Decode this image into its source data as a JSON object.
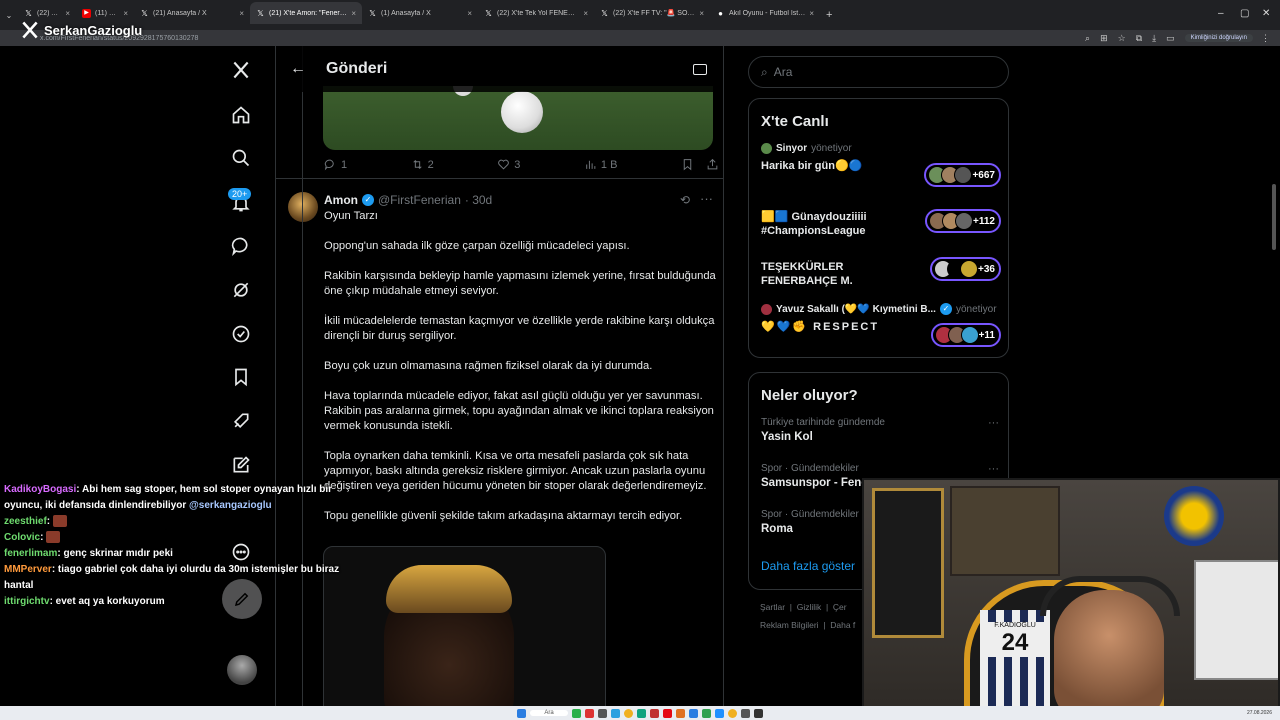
{
  "browser": {
    "tabs": [
      {
        "label": "(22) Ana",
        "icon": "x-logo",
        "active": false
      },
      {
        "label": "(11) PEDR",
        "icon": "youtube-icon",
        "active": false
      },
      {
        "label": "(21) Anasayfa / X",
        "icon": "x-logo",
        "active": false
      },
      {
        "label": "(21) X'te Amon: \"Fenerbahçe'ni",
        "icon": "x-logo",
        "active": true
      },
      {
        "label": "(1) Anasayfa / X",
        "icon": "x-logo",
        "active": false
      },
      {
        "label": "(22) X'te Tek Yol FENER: \"#SON",
        "icon": "x-logo",
        "active": false
      },
      {
        "label": "(22) X'te FF TV: \"🚨 SON DAKİ",
        "icon": "x-logo",
        "active": false
      },
      {
        "label": "Akıl Oyunu - Futbol İstatistikleri",
        "icon": "site-icon",
        "active": false
      }
    ],
    "new_tab": "+",
    "url": "x.com/FirstFenerian/status/2092928175760130278",
    "verify_label": "Kimliğinizi doğrulayın",
    "streamer_overlay": "SerkanGazioglu"
  },
  "nav": {
    "notification_badge": "20+"
  },
  "header": {
    "title": "Gönderi"
  },
  "prev_post_actions": {
    "replies": "1",
    "reposts": "2",
    "likes": "3",
    "views": "1 B"
  },
  "post": {
    "name": "Amon",
    "handle": "@FirstFenerian",
    "time": "· 30d",
    "paragraphs": [
      "Oyun Tarzı",
      "Oppong'un sahada ilk göze çarpan özelliği mücadeleci yapısı.",
      "Rakibin karşısında bekleyip hamle yapmasını izlemek yerine, fırsat bulduğunda öne çıkıp müdahale etmeyi seviyor.",
      "İkili mücadelelerde temastan kaçmıyor ve özellikle yerde rakibine karşı oldukça dirençli bir duruş sergiliyor.",
      "Boyu çok uzun olmamasına rağmen fiziksel olarak da iyi durumda.",
      "Hava toplarında mücadele ediyor, fakat asıl güçlü olduğu yer yer savunması. Rakibin pas aralarına girmek, topu ayağından almak ve ikinci toplara reaksiyon vermek konusunda istekli.",
      "Topla oynarken daha temkinli. Kısa ve orta mesafeli paslarda çok sık hata yapmıyor, baskı altında gereksiz risklere girmiyor. Ancak uzun paslarla oyunu değiştiren veya geriden hücumu yöneten bir stoper olarak değerlendiremeyiz.",
      "Topu genellikle güvenli şekilde takım arkadaşına aktarmayı tercih ediyor."
    ]
  },
  "search": {
    "placeholder": "Ara"
  },
  "live": {
    "title": "X'te Canlı",
    "items": [
      {
        "host": "Sinyor",
        "role": "yönetiyor",
        "title": "Harika bir gün🟡🔵",
        "count": "+667"
      },
      {
        "host": "",
        "role": "",
        "title": "🟨🟦 Günaydouziiiii #ChampionsLeague",
        "count": "+112"
      },
      {
        "host": "",
        "role": "",
        "title": "TEŞEKKÜRLER FENERBAHÇE M.",
        "count": "+36"
      },
      {
        "host": "Yavuz Sakallı (💛💙 Kıymetini B...",
        "role": "yönetiyor",
        "title": "💛💙✊ RESPECT",
        "count": "+11"
      }
    ]
  },
  "trends": {
    "title": "Neler oluyor?",
    "items": [
      {
        "context": "Türkiye tarihinde gündemde",
        "name": "Yasin Kol"
      },
      {
        "context": "Spor · Gündemdekiler",
        "name": "Samsunspor - Fene"
      },
      {
        "context": "Spor · Gündemdekiler",
        "name": "Roma"
      }
    ],
    "show_more": "Daha fazla göster"
  },
  "footer": {
    "links": [
      "Şartlar",
      "Gizlilik",
      "Çer",
      "Reklam Bilgileri",
      "Daha f"
    ]
  },
  "chat": [
    {
      "user": "KadikoyBogasi",
      "color": "#d86bff",
      "text": ": Abi hem sag stoper, hem sol stoper oynayan hızlı bir oyuncu, iki defansıda dinlendirebiliyor",
      "mention": "@serkangazioglu"
    },
    {
      "user": "zeesthief",
      "color": "#6fdc6f",
      "text": ": ",
      "emote": true
    },
    {
      "user": "Colovic",
      "color": "#6fdc6f",
      "text": ": ",
      "emote": true
    },
    {
      "user": "fenerlimam",
      "color": "#6fdc6f",
      "text": ": genç skrinar mıdır peki"
    },
    {
      "user": "MMPerver",
      "color": "#ff9a3c",
      "text": ": tiago gabriel çok daha iyi olurdu da 30m istemişler bu biraz hantal"
    },
    {
      "user": "ittirgichtv",
      "color": "#6fdc6f",
      "text": ": evet aq ya korkuyorum"
    }
  ],
  "webcam": {
    "jersey_name": "F.KADIOĞLU",
    "jersey_number": "24"
  },
  "taskbar": {
    "search_label": "Ara",
    "clock": "27.08.2026"
  }
}
